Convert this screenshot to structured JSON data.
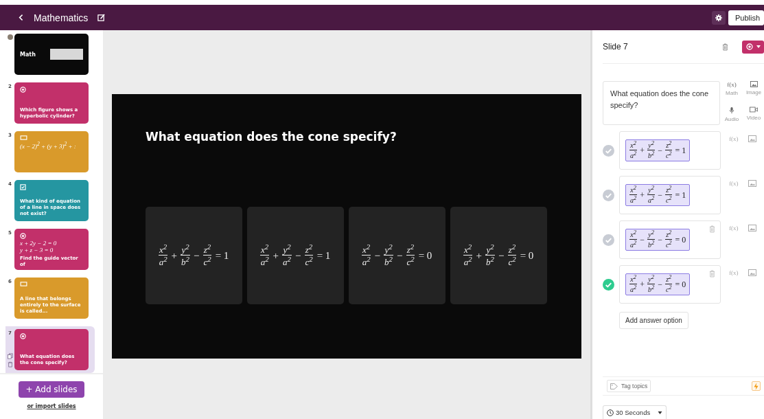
{
  "topbar": {
    "title": "Mathematics",
    "publish": "Publish"
  },
  "slides": [
    {
      "kind": "cover",
      "color": "#0a0a0a",
      "selected": false,
      "title": "Math"
    },
    {
      "number": "2",
      "kind": "single_choice",
      "color": "#c2306a",
      "selected": false,
      "lines": [
        "Which figure shows a hyperbolic cylinder?"
      ]
    },
    {
      "number": "3",
      "kind": "open",
      "color": "#d99a2b",
      "selected": false,
      "formula_lines": [
        "(x − 2)$^{2}$ + (y + 3)$^{2}$ + :"
      ]
    },
    {
      "number": "4",
      "kind": "multiple_choice",
      "color": "#2596a1",
      "selected": false,
      "lines": [
        "What kind of equation of a line in space does not exist?"
      ]
    },
    {
      "number": "5",
      "kind": "single_choice",
      "color": "#c2306a",
      "selected": false,
      "formula_lines": [
        "x + 2y − 2 = 0",
        "y + z − 3 = 0"
      ],
      "lines": [
        "Find the guide vector of"
      ]
    },
    {
      "number": "6",
      "kind": "open",
      "color": "#d99a2b",
      "selected": false,
      "lines": [
        "A line that belongs entirely to the surface is called..."
      ]
    },
    {
      "number": "7",
      "kind": "single_choice",
      "color": "#c2306a",
      "selected": true,
      "lines": [
        "What equation does the cone specify?"
      ]
    }
  ],
  "sidebar_footer": {
    "add_button": "+ Add slides",
    "import_link": "or import slides"
  },
  "canvas": {
    "question": "What equation does the cone specify?",
    "options": [
      {
        "formula": [
          {
            "kind": "frac",
            "num": "x$^{2}$",
            "den": "a$^{2}$"
          },
          {
            "kind": "op",
            "text": "+"
          },
          {
            "kind": "frac",
            "num": "y$^{2}$",
            "den": "b$^{2}$"
          },
          {
            "kind": "op",
            "text": "−"
          },
          {
            "kind": "frac",
            "num": "z$^{2}$",
            "den": "c$^{2}$"
          },
          {
            "kind": "op",
            "text": "= 1"
          }
        ]
      },
      {
        "formula": [
          {
            "kind": "frac",
            "num": "x$^{2}$",
            "den": "a$^{2}$"
          },
          {
            "kind": "op",
            "text": "+"
          },
          {
            "kind": "frac",
            "num": "y$^{2}$",
            "den": "a$^{2}$"
          },
          {
            "kind": "op",
            "text": "−"
          },
          {
            "kind": "frac",
            "num": "z$^{2}$",
            "den": "c$^{2}$"
          },
          {
            "kind": "op",
            "text": "= 1"
          }
        ]
      },
      {
        "formula": [
          {
            "kind": "frac",
            "num": "x$^{2}$",
            "den": "a$^{2}$"
          },
          {
            "kind": "op",
            "text": "−"
          },
          {
            "kind": "frac",
            "num": "y$^{2}$",
            "den": "b$^{2}$"
          },
          {
            "kind": "op",
            "text": "−"
          },
          {
            "kind": "frac",
            "num": "z$^{2}$",
            "den": "c$^{2}$"
          },
          {
            "kind": "op",
            "text": "= 0"
          }
        ]
      },
      {
        "formula": [
          {
            "kind": "frac",
            "num": "x$^{2}$",
            "den": "a$^{2}$"
          },
          {
            "kind": "op",
            "text": "+"
          },
          {
            "kind": "frac",
            "num": "y$^{2}$",
            "den": "b$^{2}$"
          },
          {
            "kind": "op",
            "text": "−"
          },
          {
            "kind": "frac",
            "num": "z$^{2}$",
            "den": "c$^{2}$"
          },
          {
            "kind": "op",
            "text": "= 0"
          }
        ]
      }
    ]
  },
  "panel": {
    "title": "Slide 7",
    "question": "What equation does the cone specify?",
    "media": [
      {
        "kind": "math",
        "icon_text": "f(x)",
        "label": "Math"
      },
      {
        "kind": "image",
        "label": "Image"
      },
      {
        "kind": "audio",
        "label": "Audio"
      },
      {
        "kind": "video",
        "label": "Video"
      }
    ],
    "answers": [
      {
        "correct": false,
        "deletable": false,
        "formula": [
          {
            "kind": "frac",
            "num": "x$^{2}$",
            "den": "a$^{2}$"
          },
          {
            "kind": "op",
            "text": "+"
          },
          {
            "kind": "frac",
            "num": "y$^{2}$",
            "den": "b$^{2}$"
          },
          {
            "kind": "op",
            "text": "−"
          },
          {
            "kind": "frac",
            "num": "z$^{2}$",
            "den": "c$^{2}$"
          },
          {
            "kind": "op",
            "text": "= 1"
          }
        ]
      },
      {
        "correct": false,
        "deletable": false,
        "formula": [
          {
            "kind": "frac",
            "num": "x$^{2}$",
            "den": "a$^{2}$"
          },
          {
            "kind": "op",
            "text": "+"
          },
          {
            "kind": "frac",
            "num": "y$^{2}$",
            "den": "a$^{2}$"
          },
          {
            "kind": "op",
            "text": "−"
          },
          {
            "kind": "frac",
            "num": "z$^{2}$",
            "den": "c$^{2}$"
          },
          {
            "kind": "op",
            "text": "= 1"
          }
        ]
      },
      {
        "correct": false,
        "deletable": true,
        "formula": [
          {
            "kind": "frac",
            "num": "x$^{2}$",
            "den": "a$^{2}$"
          },
          {
            "kind": "op",
            "text": "−"
          },
          {
            "kind": "frac",
            "num": "y$^{2}$",
            "den": "b$^{2}$"
          },
          {
            "kind": "op",
            "text": "−"
          },
          {
            "kind": "frac",
            "num": "z$^{2}$",
            "den": "c$^{2}$"
          },
          {
            "kind": "op",
            "text": "= 0"
          }
        ]
      },
      {
        "correct": true,
        "deletable": true,
        "formula": [
          {
            "kind": "frac",
            "num": "x$^{2}$",
            "den": "a$^{2}$"
          },
          {
            "kind": "op",
            "text": "+"
          },
          {
            "kind": "frac",
            "num": "y$^{2}$",
            "den": "b$^{2}$"
          },
          {
            "kind": "op",
            "text": "−"
          },
          {
            "kind": "frac",
            "num": "z$^{2}$",
            "den": "c$^{2}$"
          },
          {
            "kind": "op",
            "text": "= 0"
          }
        ]
      }
    ],
    "answer_math_icon": [
      "f(x)",
      "f(x)",
      "f(x)",
      "f(x)"
    ],
    "add_answer": "Add answer option",
    "tag_topics": "Tag topics",
    "timer": "30 Seconds"
  }
}
